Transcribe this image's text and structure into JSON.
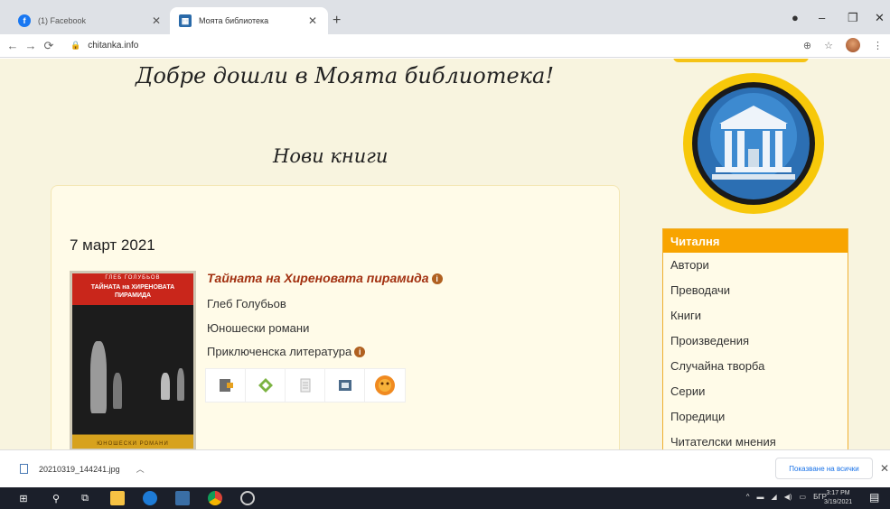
{
  "browser": {
    "tabs": [
      {
        "title": "(1) Facebook",
        "icon": "facebook-icon"
      },
      {
        "title": "Моята библиотека",
        "icon": "library-icon"
      }
    ],
    "url": "chitanka.info"
  },
  "page": {
    "welcome": "Добре дошли в Моята библиотека!",
    "section_title": "Нови книги",
    "date": "7 март 2021",
    "book": {
      "cover_author": "ГЛЕБ ГОЛУБЬОВ",
      "cover_title": "ТАЙНАТА на ХИРЕНОВАТА ПИРАМИДА",
      "cover_bottom": "ЮНОШЕСКИ РОМАНИ",
      "title": "Тайната на Хиреновата пирамида",
      "author": "Глеб Голубьов",
      "genre": "Юношески романи",
      "category": "Приключенска литература",
      "formats": [
        "fb2-icon",
        "epub-icon",
        "txt-icon",
        "sfb-icon",
        "sun-icon"
      ]
    }
  },
  "sidebar": {
    "heading": "Читалня",
    "items": [
      "Автори",
      "Преводачи",
      "Книги",
      "Произведения",
      "Случайна творба",
      "Серии",
      "Поредици",
      "Читателски мнения"
    ]
  },
  "downloads": {
    "file": "20210319_144241.jpg",
    "show_all": "Показване на всички"
  },
  "taskbar": {
    "lang": "БГР",
    "time": "3:17 PM",
    "date": "3/19/2021"
  },
  "colors": {
    "page_bg": "#f8f4df",
    "accent": "#f8a400",
    "title_red": "#a23010"
  }
}
